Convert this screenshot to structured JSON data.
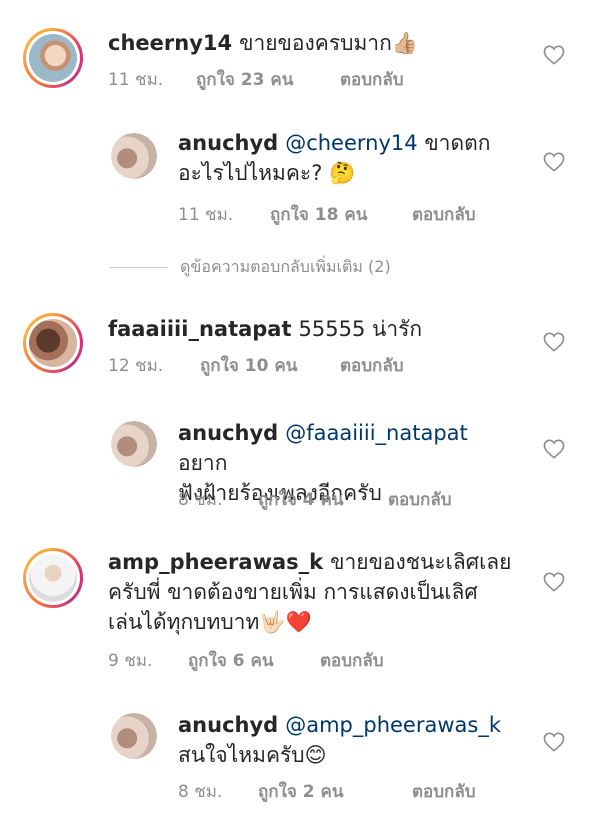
{
  "comments": [
    {
      "username": "cheerny14",
      "text": "ขายของครบมาก👍🏼",
      "time": "11 ชม.",
      "likes": "ถูกใจ 23 คน",
      "reply": "ตอบกลับ"
    },
    {
      "username": "anuchyd",
      "mention": "@cheerny14",
      "text_line1": "ขาดตก",
      "text_line2": "อะไรไปไหมคะ? 🤔",
      "time": "11 ชม.",
      "likes": "ถูกใจ 18 คน",
      "reply": "ตอบกลับ"
    },
    {
      "username": "faaaiiii_natapat",
      "text": "55555 น่ารัก",
      "time": "12 ชม.",
      "likes": "ถูกใจ 10 คน",
      "reply": "ตอบกลับ"
    },
    {
      "username": "anuchyd",
      "mention": "@faaaiiii_natapat",
      "text_line1": "อยาก",
      "text_line2": "ฟังฝ้ายร้องเพลงอีกครับ",
      "time": "8 ชม.",
      "likes": "ถูกใจ 4 คน",
      "reply": "ตอบกลับ"
    },
    {
      "username": "amp_pheerawas_k",
      "text_line1": "ขายของชนะเลิศเลย",
      "text_line2": "ครับพี่ ขาดต้องขายเพิ่ม การแสดงเป็นเลิศ",
      "text_line3": "เล่นได้ทุกบทบาท🤟🏻❤️",
      "time": "9 ชม.",
      "likes": "ถูกใจ 6 คน",
      "reply": "ตอบกลับ"
    },
    {
      "username": "anuchyd",
      "mention": "@amp_pheerawas_k",
      "text_line2": "สนใจไหมครับ😊",
      "time": "8 ชม.",
      "likes": "ถูกใจ 2 คน",
      "reply": "ตอบกลับ"
    }
  ],
  "view_more_replies": "ดูข้อความตอบกลับเพิ่มเติม (2)",
  "icons": {
    "like": "heart-outline-icon"
  },
  "colors": {
    "text": "#262626",
    "meta": "#8e8e8e",
    "mention": "#00376b"
  }
}
